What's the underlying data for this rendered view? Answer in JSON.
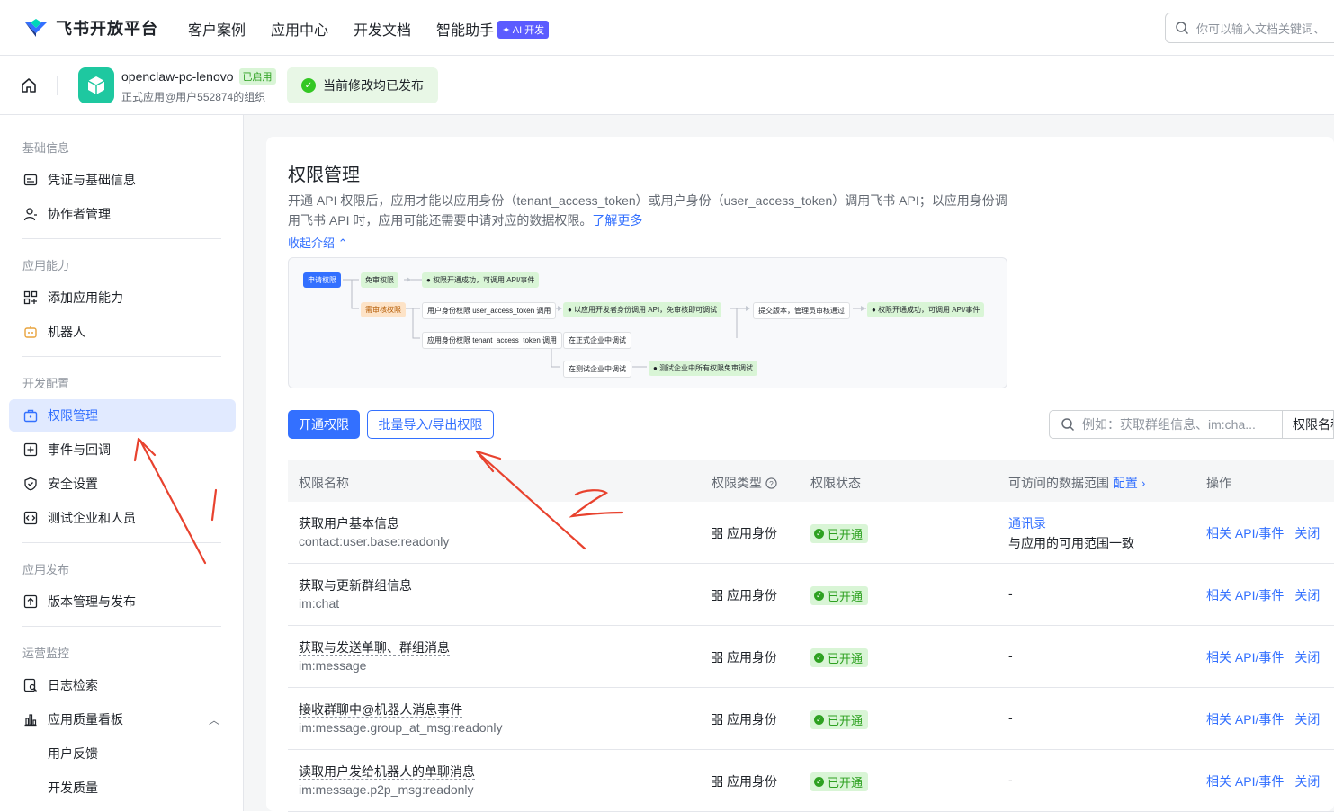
{
  "topbar": {
    "logo_text": "飞书开放平台",
    "nav": [
      "客户案例",
      "应用中心",
      "开发文档",
      "智能助手"
    ],
    "ai_badge": "✦ AI 开发",
    "search_placeholder": "你可以输入文档关键词、"
  },
  "app": {
    "name": "openclaw-pc-lenovo",
    "enabled_tag": "已启用",
    "org": "正式应用@用户552874的组织",
    "publish_status": "当前修改均已发布"
  },
  "sidebar": {
    "groups": [
      {
        "title": "基础信息",
        "items": [
          "凭证与基础信息",
          "协作者管理"
        ]
      },
      {
        "title": "应用能力",
        "items": [
          "添加应用能力",
          "机器人"
        ]
      },
      {
        "title": "开发配置",
        "items": [
          "权限管理",
          "事件与回调",
          "安全设置",
          "测试企业和人员"
        ]
      },
      {
        "title": "应用发布",
        "items": [
          "版本管理与发布"
        ]
      },
      {
        "title": "运营监控",
        "items": [
          "日志检索",
          "应用质量看板",
          "用户反馈",
          "开发质量"
        ]
      }
    ],
    "active_item": "权限管理"
  },
  "page": {
    "title": "权限管理",
    "intro": "开通 API 权限后，应用才能以应用身份（tenant_access_token）或用户身份（user_access_token）调用飞书 API；以应用身份调用飞书 API 时，应用可能还需要申请对应的数据权限。",
    "learn_more": "了解更多",
    "collapse": "收起介绍"
  },
  "diagram": {
    "apply": "申请权限",
    "no_review": "免审权限",
    "no_review_result": "权限开通成功，可调用 API/事件",
    "need_review": "需审核权限",
    "user_identity": "用户身份权限 user_access_token 调用",
    "dev_identity": "以应用开发者身份调用 API，免审核即可调试",
    "submit": "提交版本，管理员审核通过",
    "final_result": "权限开通成功，可调用 API/事件",
    "app_identity": "应用身份权限 tenant_access_token 调用",
    "formal_debug": "在正式企业中调试",
    "test_debug": "在测试企业中调试",
    "test_result": "测试企业中所有权限免审调试"
  },
  "actions": {
    "enable": "开通权限",
    "batch": "批量导入/导出权限",
    "search_placeholder": "例如：获取群组信息、im:cha...",
    "search_field": "权限名称"
  },
  "table": {
    "headers": {
      "name": "权限名称",
      "type": "权限类型",
      "status": "权限状态",
      "range": "可访问的数据范围",
      "range_config": "配置",
      "ops": "操作"
    },
    "rows": [
      {
        "name": "获取用户基本信息",
        "scope": "contact:user.base:readonly",
        "type": "应用身份",
        "status": "已开通",
        "range_link": "通讯录",
        "range": "与应用的可用范围一致",
        "op1": "相关 API/事件",
        "op2": "关闭"
      },
      {
        "name": "获取与更新群组信息",
        "scope": "im:chat",
        "type": "应用身份",
        "status": "已开通",
        "range": "-",
        "op1": "相关 API/事件",
        "op2": "关闭"
      },
      {
        "name": "获取与发送单聊、群组消息",
        "scope": "im:message",
        "type": "应用身份",
        "status": "已开通",
        "range": "-",
        "op1": "相关 API/事件",
        "op2": "关闭"
      },
      {
        "name": "接收群聊中@机器人消息事件",
        "scope": "im:message.group_at_msg:readonly",
        "type": "应用身份",
        "status": "已开通",
        "range": "-",
        "op1": "相关 API/事件",
        "op2": "关闭"
      },
      {
        "name": "读取用户发给机器人的单聊消息",
        "scope": "im:message.p2p_msg:readonly",
        "type": "应用身份",
        "status": "已开通",
        "range": "-",
        "op1": "相关 API/事件",
        "op2": "关闭"
      }
    ]
  },
  "colors": {
    "accent": "#3370ff",
    "success": "#2ea121",
    "annotation": "#e8422e"
  }
}
